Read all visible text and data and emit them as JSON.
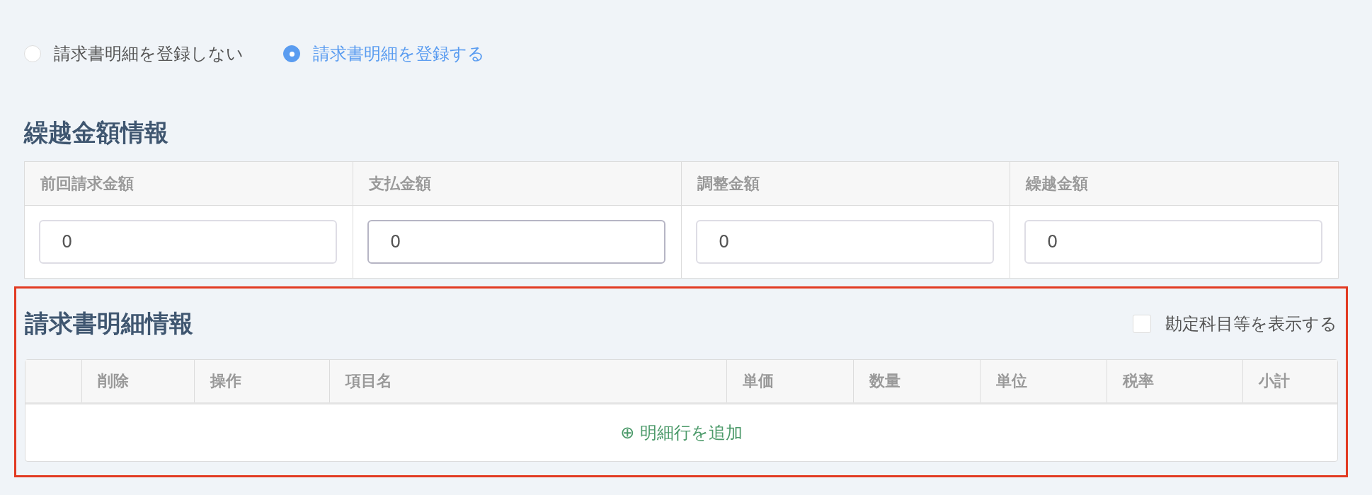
{
  "registration_options": [
    {
      "label": "請求書明細を登録しない",
      "selected": false
    },
    {
      "label": "請求書明細を登録する",
      "selected": true
    }
  ],
  "carryover": {
    "title": "繰越金額情報",
    "fields": [
      {
        "label": "前回請求金額",
        "value": "0",
        "focused": false
      },
      {
        "label": "支払金額",
        "value": "0",
        "focused": true
      },
      {
        "label": "調整金額",
        "value": "0",
        "focused": false
      },
      {
        "label": "繰越金額",
        "value": "0",
        "focused": false
      }
    ]
  },
  "details": {
    "highlighted": true,
    "title": "請求書明細情報",
    "show_accounts": {
      "label": "勘定科目等を表示する",
      "checked": false
    },
    "columns": [
      "",
      "削除",
      "操作",
      "項目名",
      "単価",
      "数量",
      "単位",
      "税率",
      "小計"
    ],
    "add_row": {
      "icon": "⊕",
      "label": "明細行を追加"
    }
  }
}
